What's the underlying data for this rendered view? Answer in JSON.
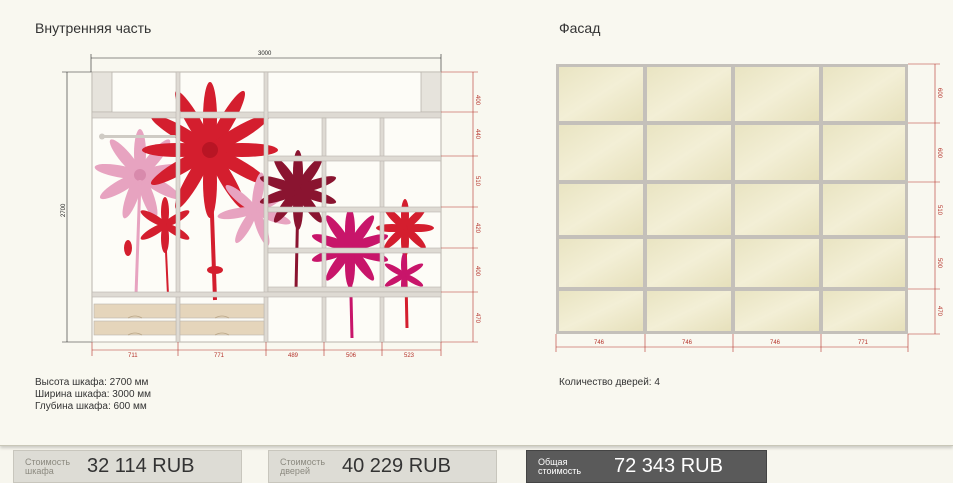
{
  "inner": {
    "title": "Внутренняя часть",
    "dims_top": "3000",
    "dims_left": "2700",
    "dims_right": [
      "400",
      "440",
      "510",
      "420",
      "400",
      "470"
    ],
    "dims_bottom": [
      "711",
      "771",
      "489",
      "506",
      "523"
    ],
    "info_height": "Высота шкафа: 2700 мм",
    "info_width": "Ширина шкафа: 3000 мм",
    "info_depth": "Глубина шкафа: 600 мм"
  },
  "facade": {
    "title": "Фасад",
    "dims_right": [
      "600",
      "600",
      "510",
      "500",
      "470"
    ],
    "dims_bottom": [
      "746",
      "746",
      "746",
      "771"
    ],
    "info_doors": "Количество дверей: 4"
  },
  "prices": {
    "cabinet_label": "Стоимость шкафа",
    "cabinet_value": "32 114  RUB",
    "doors_label": "Стоимость дверей",
    "doors_value": "40 229  RUB",
    "total_label": "Общая стоимость",
    "total_value": "72 343  RUB"
  },
  "colors": {
    "background": "#f9f8f0",
    "frame": "#b9b5ad",
    "panel_fill": "#eee9c8",
    "dimension_red": "#b5322a",
    "flower_red": "#d41e2e",
    "flower_pink": "#e7a3c0",
    "flower_magenta": "#c8156a",
    "flower_dark": "#8a1430",
    "total_bg": "#5a5a5a"
  }
}
